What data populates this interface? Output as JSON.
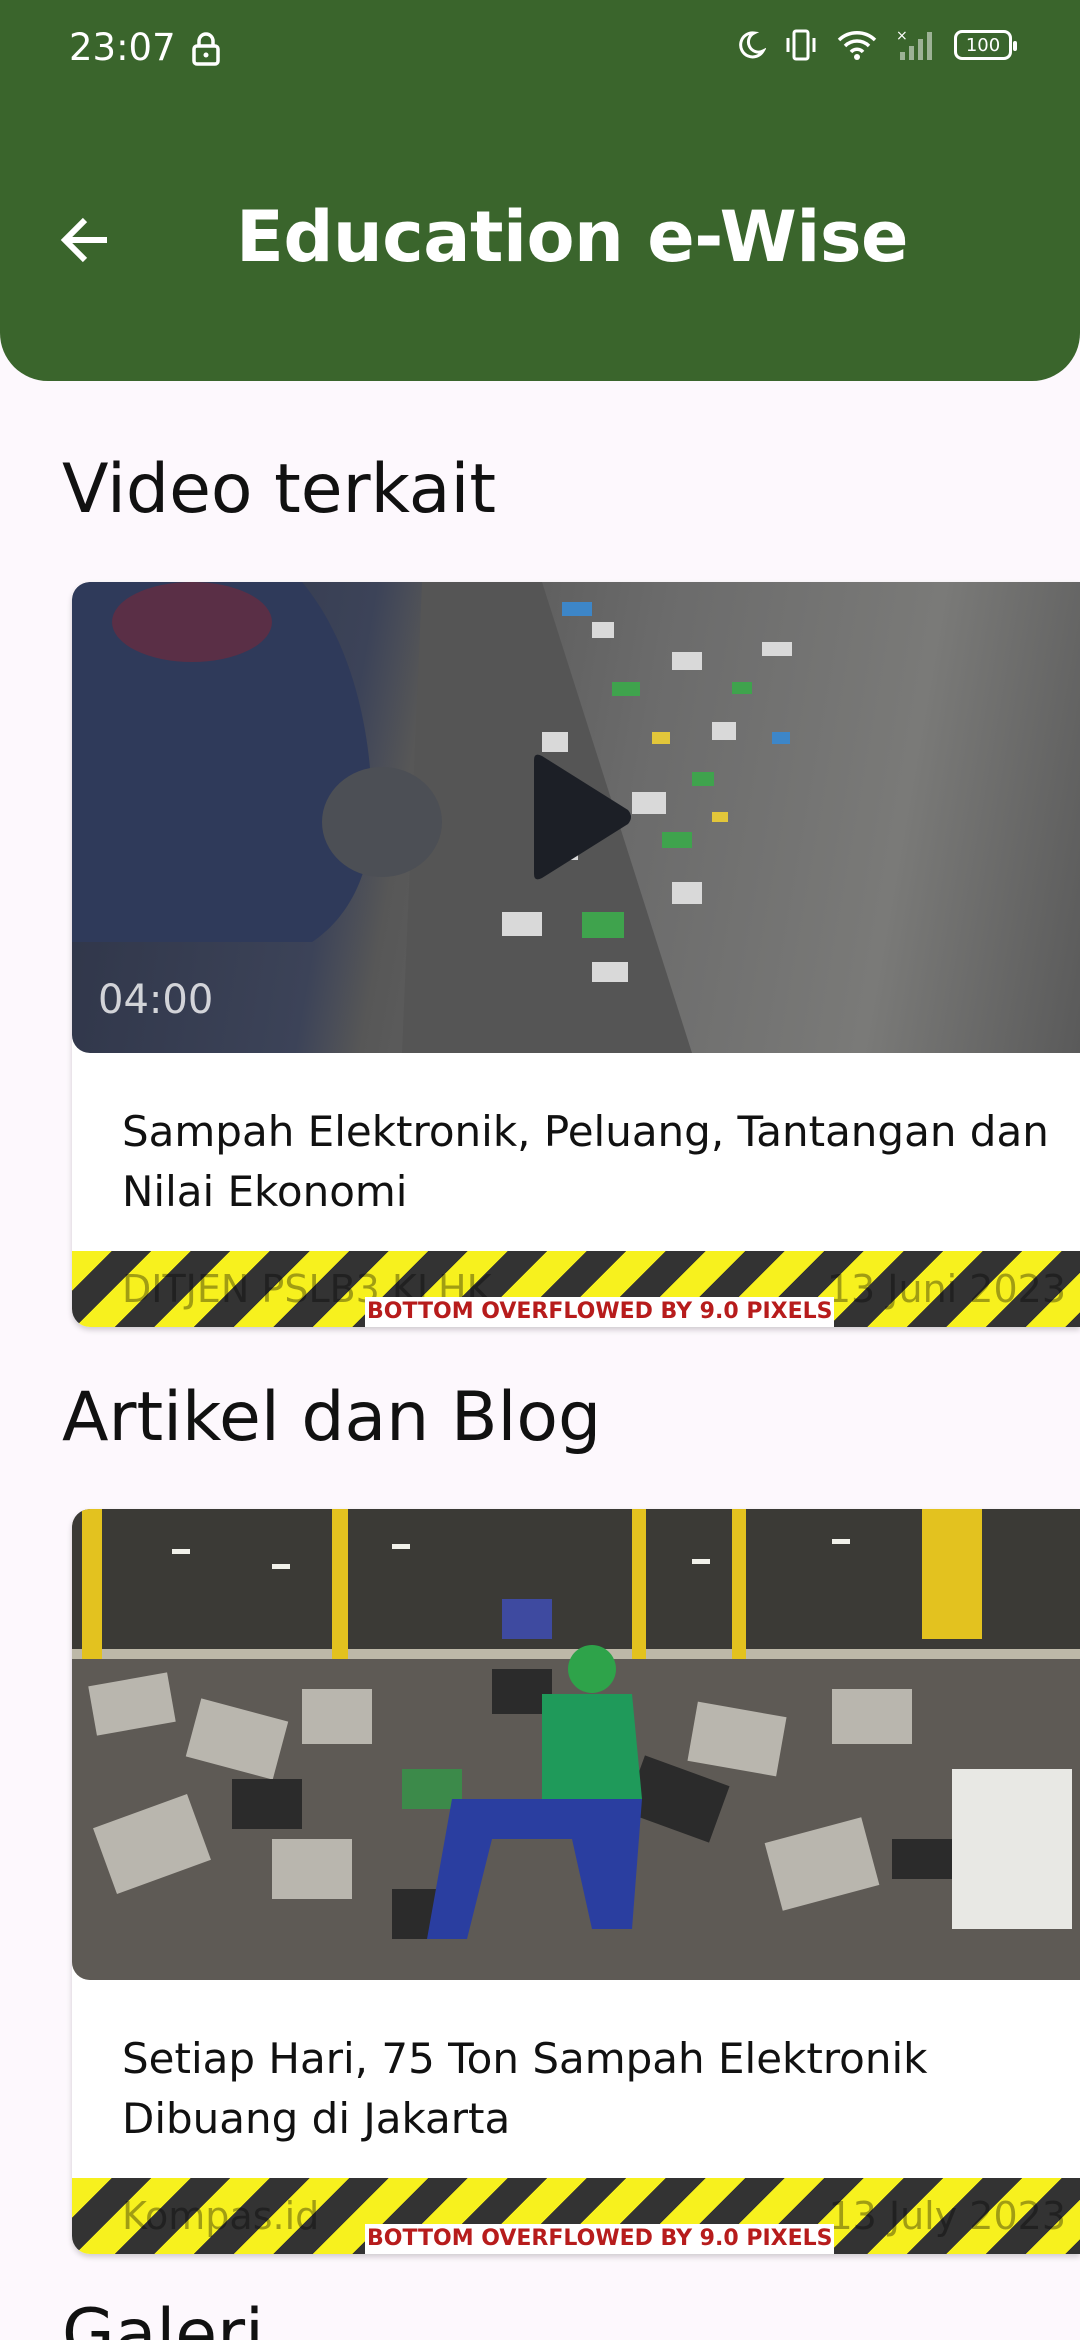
{
  "status_bar": {
    "time": "23:07",
    "battery": "100"
  },
  "header": {
    "title": "Education e-Wise"
  },
  "sections": {
    "videos": {
      "title": "Video terkait",
      "item": {
        "duration": "04:00",
        "title": "Sampah Elektronik, Peluang, Tantangan dan Nilai Ekonomi",
        "source": "DITJEN PSLB3 KLHK",
        "date": "13 Juni 2023",
        "overflow_text": "BOTTOM OVERFLOWED BY 9.0 PIXELS"
      }
    },
    "articles": {
      "title": "Artikel dan Blog",
      "item": {
        "title": "Setiap Hari, 75 Ton Sampah Elektronik Dibuang di Jakarta",
        "source": "Kompas.id",
        "date": "13 July 2023",
        "overflow_text": "BOTTOM OVERFLOWED BY 9.0 PIXELS"
      }
    },
    "gallery": {
      "title": "Galeri"
    }
  },
  "colors": {
    "appbar": "#3a652c",
    "background": "#fdf8fd",
    "overflow_text": "#b71c1c"
  }
}
